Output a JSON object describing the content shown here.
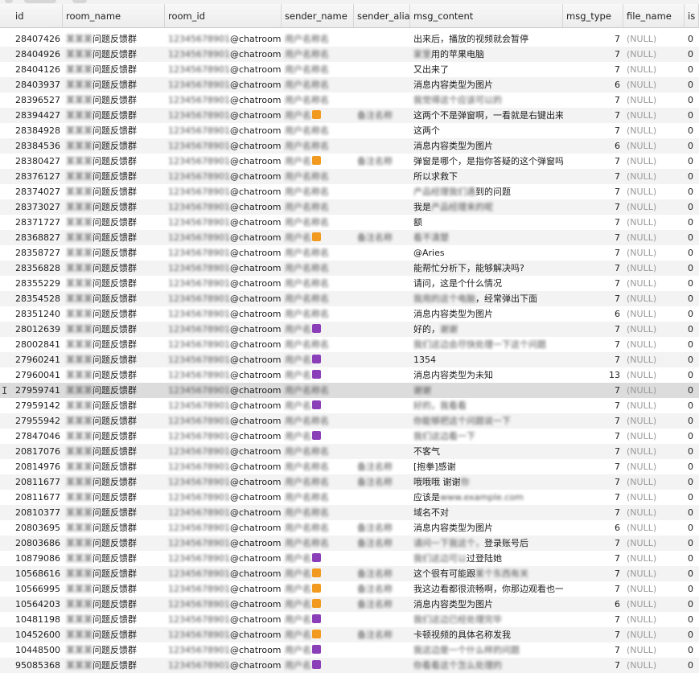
{
  "columns": [
    "id",
    "room_name",
    "room_id",
    "sender_name",
    "sender_alias",
    "msg_content",
    "msg_type",
    "file_name",
    "is"
  ],
  "null_text": "(NULL)",
  "room_suffix": "@chatroom",
  "rows": [
    {
      "id": "28407426",
      "room": "问题反馈群",
      "content": "出来后，播放的视频就会暂停",
      "type": "7",
      "is": "0",
      "alias": false,
      "emoji": ""
    },
    {
      "id": "28404926",
      "room": "问题反馈群",
      "content_blur": "家里",
      "content": "用的苹果电脑",
      "type": "7",
      "is": "0",
      "alias": false,
      "emoji": ""
    },
    {
      "id": "28404126",
      "room": "问题反馈群",
      "content": "又出来了",
      "type": "7",
      "is": "0",
      "alias": false,
      "emoji": ""
    },
    {
      "id": "28403937",
      "room": "问题反馈群",
      "content": "消息内容类型为图片",
      "type": "6",
      "is": "0",
      "alias": false,
      "emoji": ""
    },
    {
      "id": "28396527",
      "room": "问题反馈群",
      "content_blur": "我觉得这个应该可以的",
      "content": "",
      "type": "7",
      "is": "0",
      "alias": false,
      "emoji": ""
    },
    {
      "id": "28394427",
      "room": "问题反馈群",
      "content": "这两个不是弹窗啊，一看就是右键出来",
      "type": "7",
      "is": "0",
      "alias": true,
      "emoji": "orange"
    },
    {
      "id": "28384928",
      "room": "问题反馈群",
      "content": "这两个",
      "type": "7",
      "is": "0",
      "alias": false,
      "emoji": ""
    },
    {
      "id": "28384536",
      "room": "问题反馈群",
      "content": "消息内容类型为图片",
      "type": "6",
      "is": "0",
      "alias": false,
      "emoji": ""
    },
    {
      "id": "28380427",
      "room": "问题反馈群",
      "content": "弹窗是哪个，是指你答疑的这个弹窗吗",
      "type": "7",
      "is": "0",
      "alias": true,
      "emoji": "orange"
    },
    {
      "id": "28376127",
      "room": "问题反馈群",
      "content": "所以求救下",
      "type": "7",
      "is": "0",
      "alias": false,
      "emoji": ""
    },
    {
      "id": "28374027",
      "room": "问题反馈群",
      "content_blur": "产品经理我们遇",
      "content": "到的问题",
      "type": "7",
      "is": "0",
      "alias": false,
      "emoji": ""
    },
    {
      "id": "28373027",
      "room": "问题反馈群",
      "content": "我是",
      "content_blur": "产品经理来的呢",
      "type": "7",
      "is": "0",
      "alias": false,
      "emoji": ""
    },
    {
      "id": "28371727",
      "room": "问题反馈群",
      "content": "额",
      "type": "7",
      "is": "0",
      "alias": false,
      "emoji": ""
    },
    {
      "id": "28368827",
      "room": "问题反馈群",
      "content_blur": "看不清楚",
      "content": "",
      "type": "7",
      "is": "0",
      "alias": true,
      "emoji": "orange"
    },
    {
      "id": "28358727",
      "room": "问题反馈群",
      "content": "@Aries",
      "type": "7",
      "is": "0",
      "alias": false,
      "emoji": ""
    },
    {
      "id": "28356828",
      "room": "问题反馈群",
      "content": "能帮忙分析下，能够解决吗?",
      "type": "7",
      "is": "0",
      "alias": false,
      "emoji": ""
    },
    {
      "id": "28355229",
      "room": "问题反馈群",
      "content": "请问，这是个什么情况",
      "type": "7",
      "is": "0",
      "alias": false,
      "emoji": ""
    },
    {
      "id": "28354528",
      "room": "问题反馈群",
      "content_blur": "我用的这个电脑",
      "content": "，经常弹出下面",
      "type": "7",
      "is": "0",
      "alias": false,
      "emoji": ""
    },
    {
      "id": "28351240",
      "room": "问题反馈群",
      "content": "消息内容类型为图片",
      "type": "6",
      "is": "0",
      "alias": false,
      "emoji": ""
    },
    {
      "id": "28012639",
      "room": "问题反馈群",
      "content": "好的，",
      "content_blur": "谢谢",
      "type": "7",
      "is": "0",
      "alias": false,
      "emoji": "purple"
    },
    {
      "id": "28002841",
      "room": "问题反馈群",
      "content_blur": "我们这边会尽快处理一下这个问题",
      "content": "",
      "type": "7",
      "is": "0",
      "alias": false,
      "emoji": ""
    },
    {
      "id": "27960241",
      "room": "问题反馈群",
      "content": "1354",
      "type": "7",
      "is": "0",
      "alias": false,
      "emoji": "purple"
    },
    {
      "id": "27960041",
      "room": "问题反馈群",
      "content": "消息内容类型为未知",
      "type": "13",
      "is": "0",
      "alias": false,
      "emoji": "purple"
    },
    {
      "id": "27959741",
      "room": "问题反馈群",
      "content_blur": "谢谢",
      "content": "",
      "type": "7",
      "is": "0",
      "alias": false,
      "emoji": "",
      "selected": true
    },
    {
      "id": "27959142",
      "room": "问题反馈群",
      "content_blur": "好的，我看看",
      "content": "",
      "type": "7",
      "is": "0",
      "alias": false,
      "emoji": "purple"
    },
    {
      "id": "27955942",
      "room": "问题反馈群",
      "content_blur": "你能够把这个问题说一下",
      "content": "",
      "type": "7",
      "is": "0",
      "alias": false,
      "emoji": ""
    },
    {
      "id": "27847046",
      "room": "问题反馈群",
      "content_blur": "我们这边看一下",
      "content": "",
      "type": "7",
      "is": "0",
      "alias": false,
      "emoji": "purple"
    },
    {
      "id": "20817076",
      "room": "问题反馈群",
      "content": "不客气",
      "type": "7",
      "is": "0",
      "alias": false,
      "emoji": ""
    },
    {
      "id": "20814976",
      "room": "问题反馈群",
      "content": "[抱拳]感谢",
      "type": "7",
      "is": "0",
      "alias": true,
      "emoji": ""
    },
    {
      "id": "20811677",
      "room": "问题反馈群",
      "content": "哦哦哦 谢谢",
      "content_blur": "你",
      "type": "7",
      "is": "0",
      "alias": true,
      "emoji": ""
    },
    {
      "id": "20811677",
      "room": "问题反馈群",
      "content": "应该是",
      "content_blur": "www.example.com",
      "type": "7",
      "is": "0",
      "alias": false,
      "emoji": ""
    },
    {
      "id": "20810377",
      "room": "问题反馈群",
      "content": "域名不对",
      "type": "7",
      "is": "0",
      "alias": false,
      "emoji": ""
    },
    {
      "id": "20803695",
      "room": "问题反馈群",
      "content": "消息内容类型为图片",
      "type": "6",
      "is": "0",
      "alias": true,
      "emoji": ""
    },
    {
      "id": "20803686",
      "room": "问题反馈群",
      "content_blur": "请问一下我这个，",
      "content": "登录账号后",
      "type": "7",
      "is": "0",
      "alias": true,
      "emoji": ""
    },
    {
      "id": "10879086",
      "room": "问题反馈群",
      "content_blur": "我们这边可以",
      "content": "过登陆她",
      "type": "7",
      "is": "0",
      "alias": false,
      "emoji": "purple"
    },
    {
      "id": "10568616",
      "room": "问题反馈群",
      "content": "这个很有可能跟",
      "content_blur": "某个东西有关",
      "type": "7",
      "is": "0",
      "alias": true,
      "emoji": "orange"
    },
    {
      "id": "10566995",
      "room": "问题反馈群",
      "content": "我这边看都很流畅啊，你那边观看也一",
      "type": "7",
      "is": "0",
      "alias": true,
      "emoji": "orange"
    },
    {
      "id": "10564203",
      "room": "问题反馈群",
      "content": "消息内容类型为图片",
      "type": "6",
      "is": "0",
      "alias": true,
      "emoji": "orange"
    },
    {
      "id": "10481198",
      "room": "问题反馈群",
      "content_blur": "我们这边已经处理完毕",
      "content": "",
      "type": "7",
      "is": "0",
      "alias": false,
      "emoji": "purple"
    },
    {
      "id": "10452600",
      "room": "问题反馈群",
      "content": "卡顿视频的具体名称发我",
      "type": "7",
      "is": "0",
      "alias": true,
      "emoji": "orange"
    },
    {
      "id": "10448500",
      "room": "问题反馈群",
      "content_blur": "我这边是一个什么样的问题",
      "content": "",
      "type": "7",
      "is": "0",
      "alias": false,
      "emoji": "purple"
    },
    {
      "id": "95085368",
      "room": "问题反馈群",
      "content_blur": "你看看这个怎么处理的",
      "content": "",
      "type": "7",
      "is": "0",
      "alias": false,
      "emoji": "purple"
    }
  ]
}
